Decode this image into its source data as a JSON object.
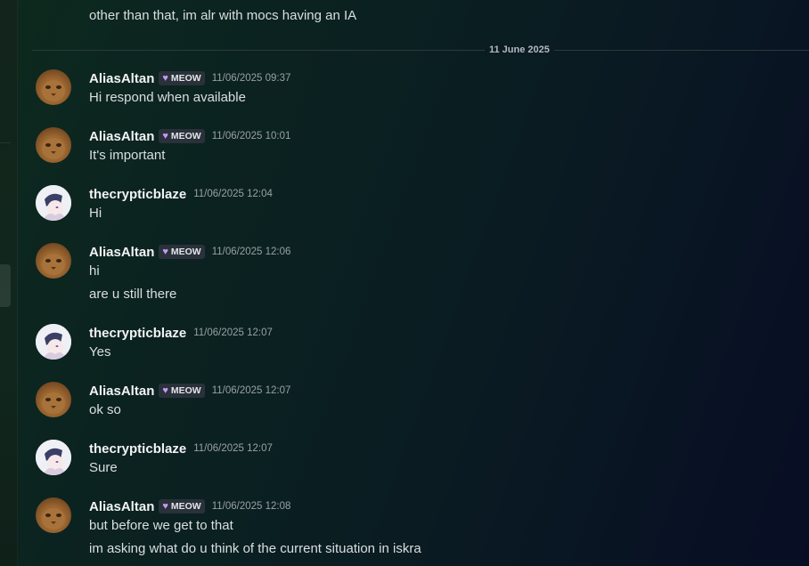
{
  "top_message": {
    "text": "other than that, im alr with mocs having an IA"
  },
  "date_separator": "11 June 2025",
  "tag_label": "MEOW",
  "messages": [
    {
      "user": "AliasAltan",
      "time": "11/06/2025 09:37",
      "lines": [
        "Hi respond when available"
      ]
    },
    {
      "user": "AliasAltan",
      "time": "11/06/2025 10:01",
      "lines": [
        "It's important"
      ]
    },
    {
      "user": "thecrypticblaze",
      "time": "11/06/2025 12:04",
      "lines": [
        "Hi"
      ]
    },
    {
      "user": "AliasAltan",
      "time": "11/06/2025 12:06",
      "lines": [
        "hi",
        "are u still there"
      ]
    },
    {
      "user": "thecrypticblaze",
      "time": "11/06/2025 12:07",
      "lines": [
        "Yes"
      ]
    },
    {
      "user": "AliasAltan",
      "time": "11/06/2025 12:07",
      "lines": [
        "ok so"
      ]
    },
    {
      "user": "thecrypticblaze",
      "time": "11/06/2025 12:07",
      "lines": [
        "Sure"
      ]
    },
    {
      "user": "AliasAltan",
      "time": "11/06/2025 12:08",
      "lines": [
        "but before we get to that",
        "im asking what do u think of the current situation in iskra"
      ]
    }
  ],
  "colors": {
    "background_start": "#0d2a1e",
    "background_end": "#080d24",
    "username": "#f2f3f5",
    "message_text": "#dbdee1",
    "timestamp": "#9aa0a6",
    "tag_heart": "#c39bf5"
  }
}
